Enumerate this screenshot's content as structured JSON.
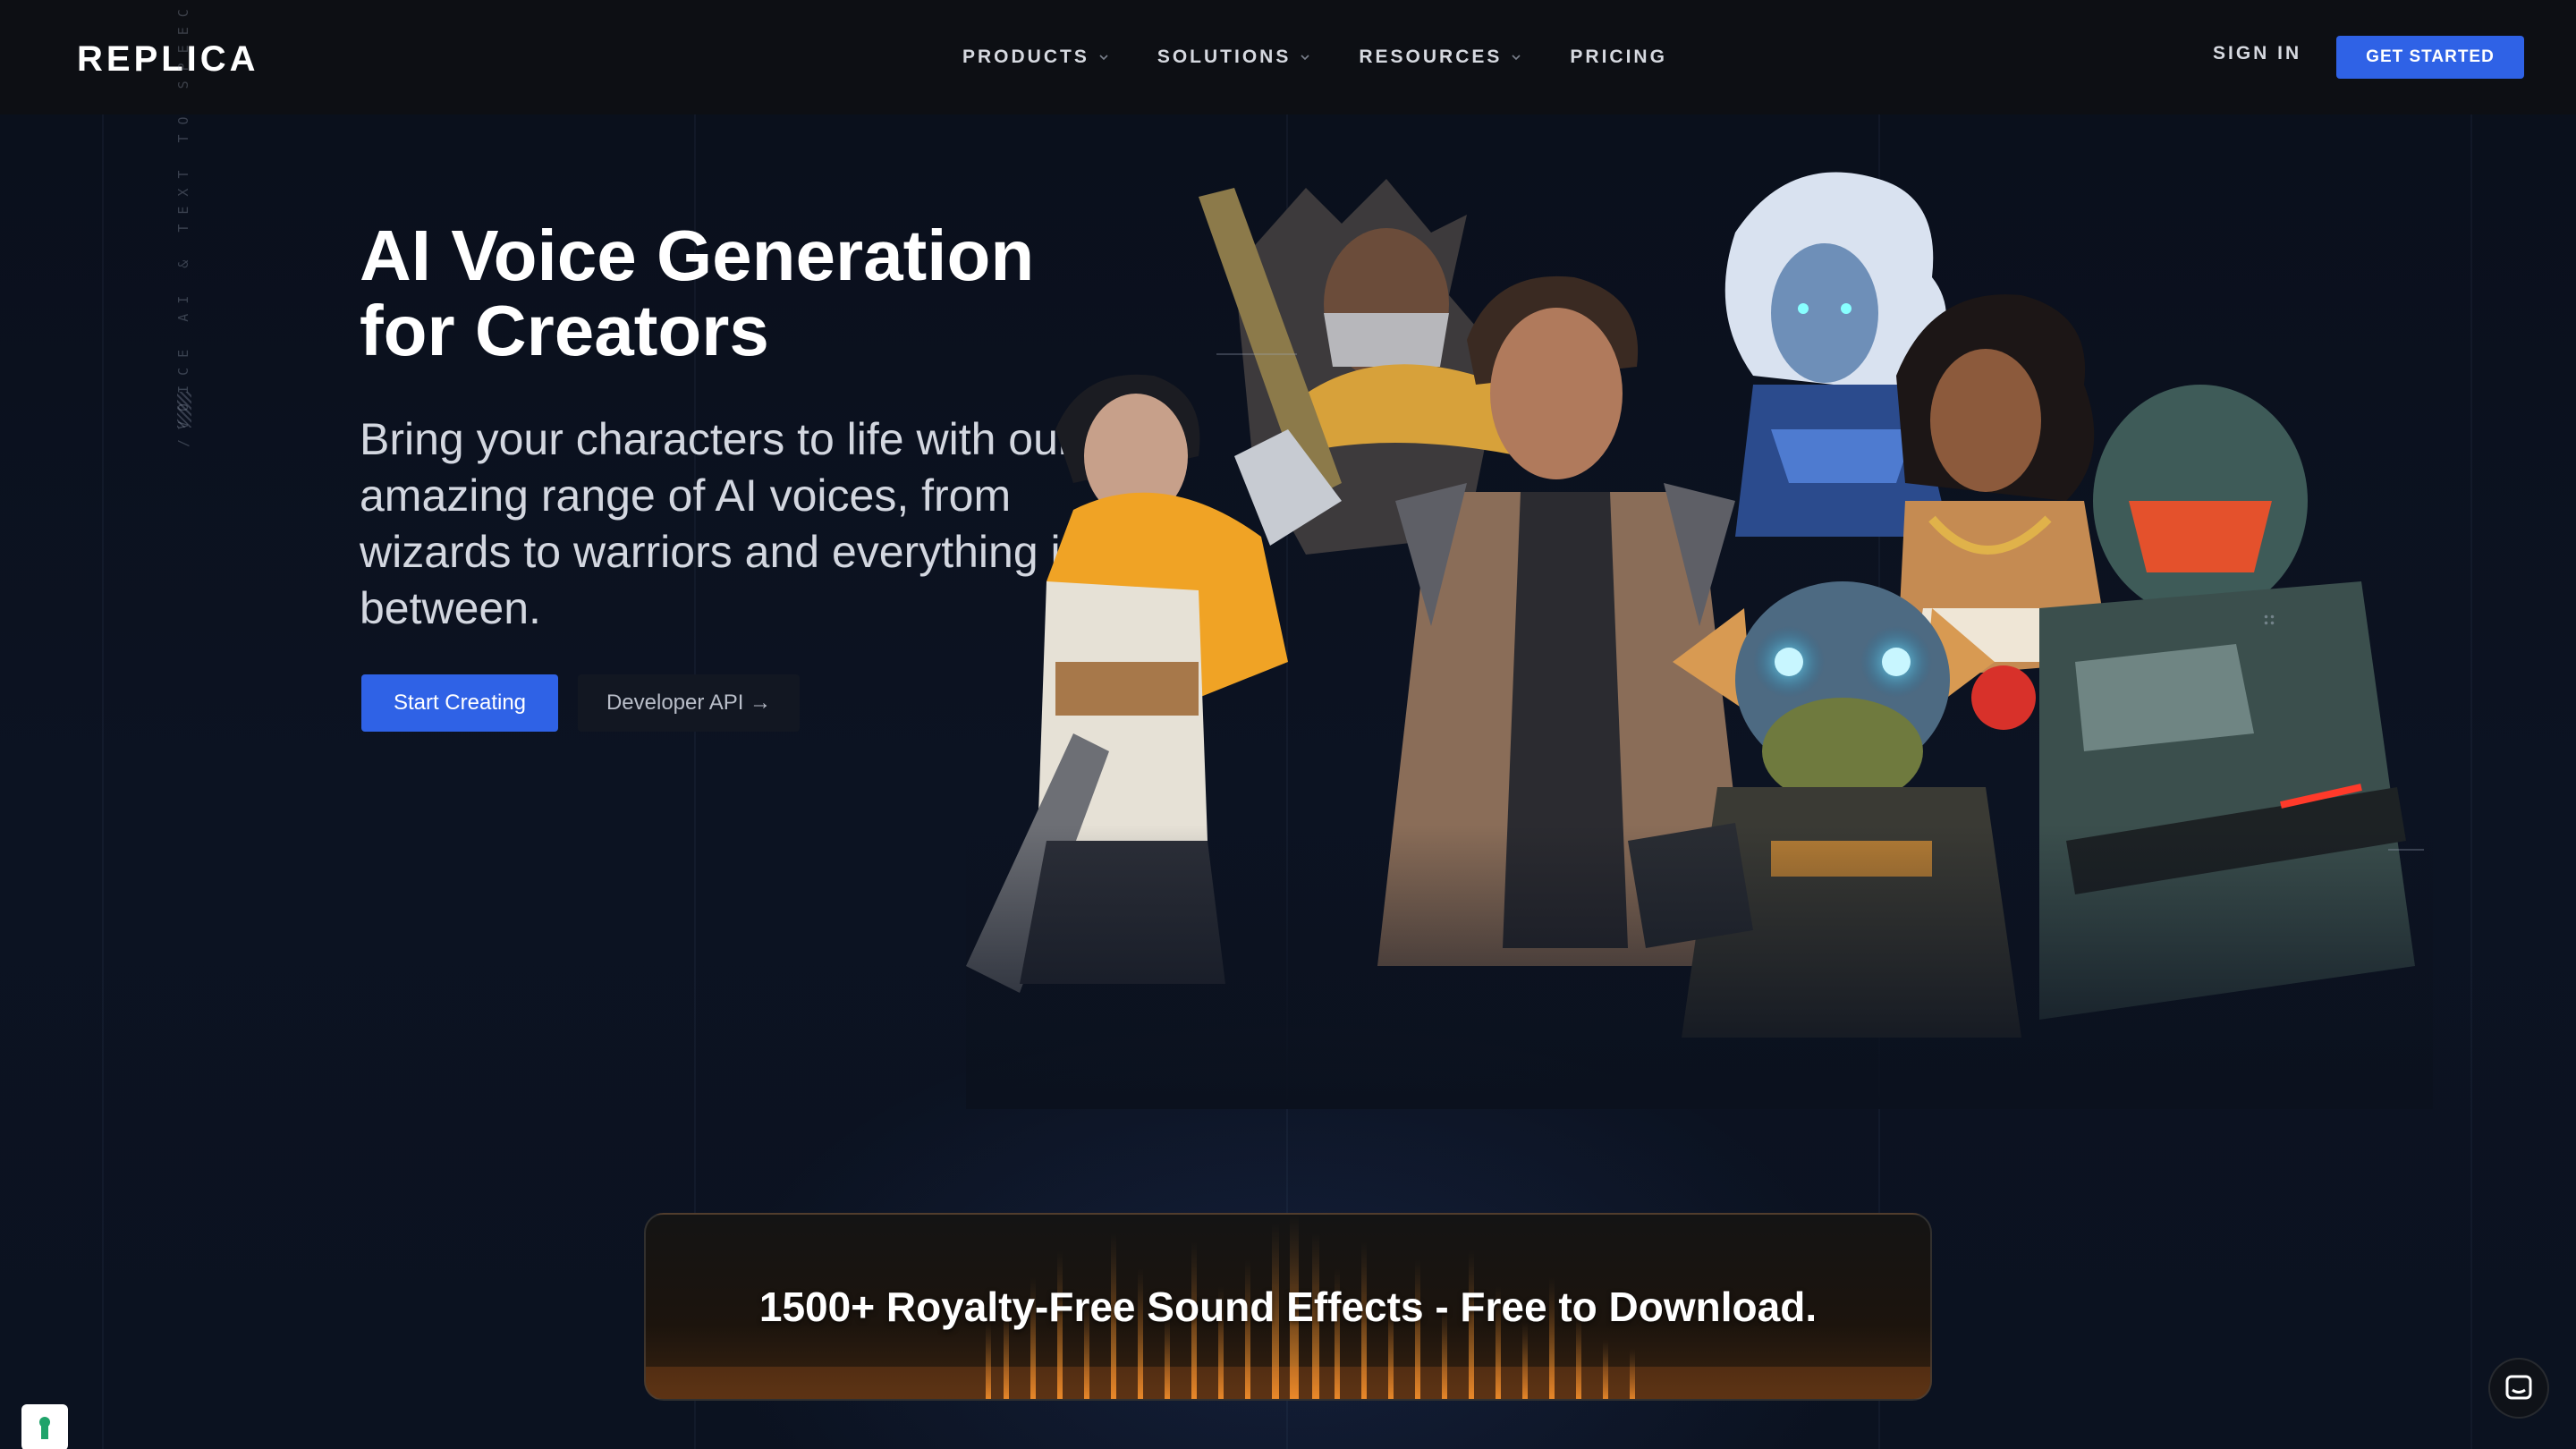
{
  "brand": {
    "logo_text": "REPLICA"
  },
  "nav": {
    "items": [
      {
        "label": "PRODUCTS",
        "has_dropdown": true
      },
      {
        "label": "SOLUTIONS",
        "has_dropdown": true
      },
      {
        "label": "RESOURCES",
        "has_dropdown": true
      },
      {
        "label": "PRICING",
        "has_dropdown": false
      }
    ],
    "sign_in": "SIGN IN",
    "get_started": "GET STARTED"
  },
  "side_label": "/VOICE AI & TEXT TO SPEECH",
  "hero": {
    "title": "AI Voice Generation for Creators",
    "subtitle": "Bring your characters to life with our amazing range of AI voices, from wizards to warriors and everything in between.",
    "primary_button": "Start Creating",
    "secondary_button": "Developer API →"
  },
  "banner": {
    "text": "1500+ Royalty-Free Sound Effects - Free to Download."
  },
  "colors": {
    "accent": "#2f62e6",
    "background": "#0b111e",
    "nav_bg": "#0d0f14"
  }
}
